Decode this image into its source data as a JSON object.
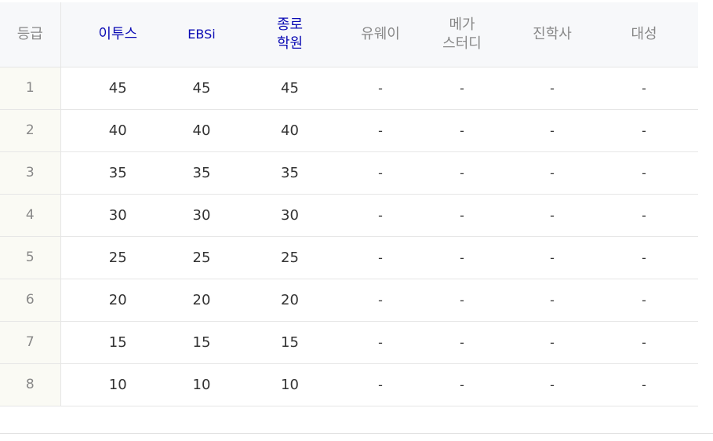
{
  "table": {
    "headers": [
      {
        "label": "등급",
        "lines": [
          "등급"
        ],
        "highlight": false
      },
      {
        "label": "이투스",
        "lines": [
          "이투스"
        ],
        "highlight": true
      },
      {
        "label": "EBSi",
        "lines": [
          "EBSi"
        ],
        "highlight": true
      },
      {
        "label": "종로 학원",
        "lines": [
          "종로",
          "학원"
        ],
        "highlight": true
      },
      {
        "label": "유웨이",
        "lines": [
          "유웨이"
        ],
        "highlight": false
      },
      {
        "label": "메가 스터디",
        "lines": [
          "메가",
          "스터디"
        ],
        "highlight": false
      },
      {
        "label": "진학사",
        "lines": [
          "진학사"
        ],
        "highlight": false
      },
      {
        "label": "대성",
        "lines": [
          "대성"
        ],
        "highlight": false
      }
    ],
    "rows": [
      [
        "1",
        "45",
        "45",
        "45",
        "-",
        "-",
        "-",
        "-"
      ],
      [
        "2",
        "40",
        "40",
        "40",
        "-",
        "-",
        "-",
        "-"
      ],
      [
        "3",
        "35",
        "35",
        "35",
        "-",
        "-",
        "-",
        "-"
      ],
      [
        "4",
        "30",
        "30",
        "30",
        "-",
        "-",
        "-",
        "-"
      ],
      [
        "5",
        "25",
        "25",
        "25",
        "-",
        "-",
        "-",
        "-"
      ],
      [
        "6",
        "20",
        "20",
        "20",
        "-",
        "-",
        "-",
        "-"
      ],
      [
        "7",
        "15",
        "15",
        "15",
        "-",
        "-",
        "-",
        "-"
      ],
      [
        "8",
        "10",
        "10",
        "10",
        "-",
        "-",
        "-",
        "-"
      ]
    ]
  },
  "colors": {
    "highlight_header": "#0a0ab4",
    "muted_header": "#888888",
    "header_background": "#f7f8fa",
    "grade_column_background": "#fafaf4"
  }
}
